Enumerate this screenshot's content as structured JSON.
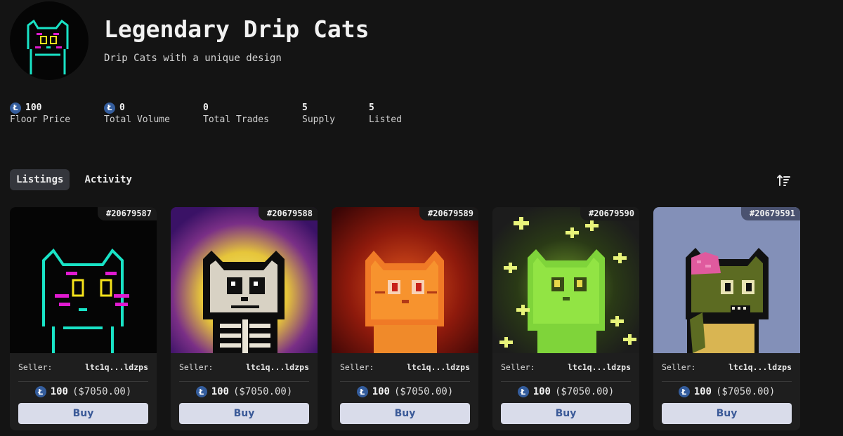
{
  "collection": {
    "title": "Legendary Drip Cats",
    "subtitle": "Drip Cats with a unique design"
  },
  "stats": [
    {
      "value": "100",
      "label": "Floor Price",
      "has_coin": true
    },
    {
      "value": "0",
      "label": "Total Volume",
      "has_coin": true
    },
    {
      "value": "0",
      "label": "Total Trades",
      "has_coin": false
    },
    {
      "value": "5",
      "label": "Supply",
      "has_coin": false
    },
    {
      "value": "5",
      "label": "Listed",
      "has_coin": false
    }
  ],
  "coin_icon": "litecoin-icon",
  "coin_glyph": "Ł",
  "tabs": [
    {
      "label": "Listings",
      "active": true
    },
    {
      "label": "Activity",
      "active": false
    }
  ],
  "sort_icon": "sort-icon",
  "cards": [
    {
      "token": "#20679587",
      "seller_label": "Seller:",
      "seller": "ltc1q...ldzps",
      "price": "100",
      "usd": "($7050.00)",
      "buy_label": "Buy",
      "art": "neon-cat"
    },
    {
      "token": "#20679588",
      "seller_label": "Seller:",
      "seller": "ltc1q...ldzps",
      "price": "100",
      "usd": "($7050.00)",
      "buy_label": "Buy",
      "art": "skeleton-cat"
    },
    {
      "token": "#20679589",
      "seller_label": "Seller:",
      "seller": "ltc1q...ldzps",
      "price": "100",
      "usd": "($7050.00)",
      "buy_label": "Buy",
      "art": "fire-cat"
    },
    {
      "token": "#20679590",
      "seller_label": "Seller:",
      "seller": "ltc1q...ldzps",
      "price": "100",
      "usd": "($7050.00)",
      "buy_label": "Buy",
      "art": "toxic-cat"
    },
    {
      "token": "#20679591",
      "seller_label": "Seller:",
      "seller": "ltc1q...ldzps",
      "price": "100",
      "usd": "($7050.00)",
      "buy_label": "Buy",
      "art": "zombie-cat"
    }
  ],
  "colors": {
    "background": "#141414",
    "card": "#1e1e1e",
    "coin": "#345d9d",
    "buy_bg": "#d9dcea",
    "buy_text": "#3b5a98"
  }
}
